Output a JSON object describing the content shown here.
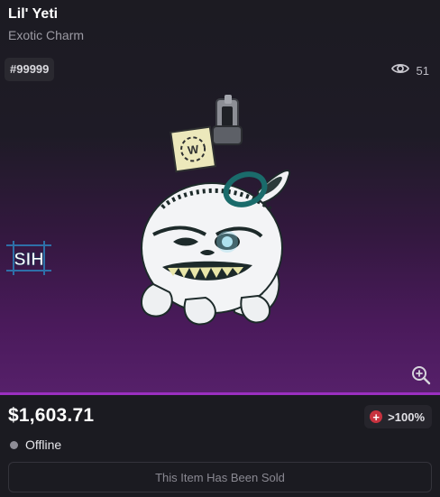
{
  "item": {
    "name": "Lil' Yeti",
    "category": "Exotic Charm",
    "id_tag": "#99999",
    "view_count": "51"
  },
  "icons": {
    "views": "eye-icon",
    "zoom": "zoom-in-icon",
    "logo": "sih-logo",
    "change": "plus-circle-icon",
    "status": "status-dot"
  },
  "colors": {
    "accent": "#9a2fc0",
    "change_badge": "#c8323f",
    "status_offline": "#8e8d96"
  },
  "market": {
    "price": "$1,603.71",
    "change": ">100%",
    "status": "Offline",
    "sold_label": "This Item Has Been Sold"
  }
}
